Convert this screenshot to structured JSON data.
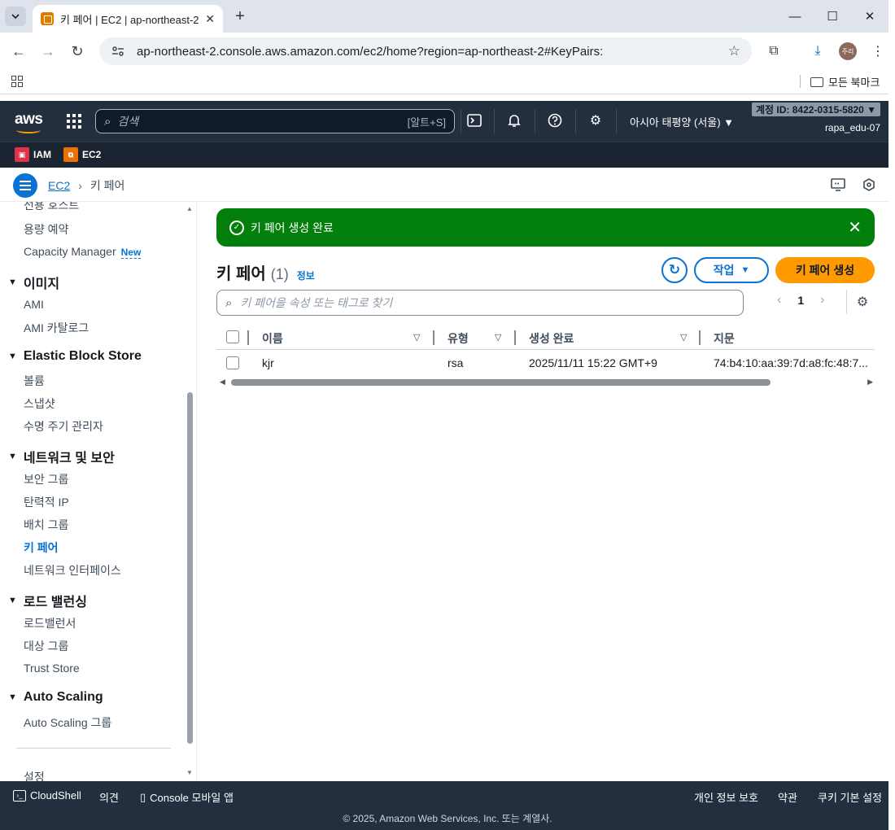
{
  "browser": {
    "tab_title": "키 페어 | EC2 | ap-northeast-2",
    "tab_close": "✕",
    "new_tab": "+",
    "url": "ap-northeast-2.console.aws.amazon.com/ec2/home?region=ap-northeast-2#KeyPairs:",
    "profile_initials": "주리",
    "bookmarks_all": "모든 북마크"
  },
  "aws_header": {
    "search_placeholder": "검색",
    "search_shortcut": "[알트+S]",
    "region": "아시아 태평양 (서울) ▼",
    "account": "계정 ID: 8422-0315-5820 ▼",
    "user": "rapa_edu-07",
    "favorites": [
      {
        "label": "IAM",
        "color": "#dd344c"
      },
      {
        "label": "EC2",
        "color": "#ed7100"
      }
    ]
  },
  "breadcrumb": {
    "parent": "EC2",
    "current": "키 페어"
  },
  "sidenav": {
    "items": [
      {
        "type": "link",
        "label": "전용 호스트"
      },
      {
        "type": "link",
        "label": "용량 예약"
      },
      {
        "type": "link",
        "label": "Capacity Manager",
        "badge": "New"
      },
      {
        "type": "section",
        "label": "이미지"
      },
      {
        "type": "link",
        "label": "AMI"
      },
      {
        "type": "link",
        "label": "AMI 카탈로그"
      },
      {
        "type": "section",
        "label": "Elastic Block Store"
      },
      {
        "type": "link",
        "label": "볼륨"
      },
      {
        "type": "link",
        "label": "스냅샷"
      },
      {
        "type": "link",
        "label": "수명 주기 관리자"
      },
      {
        "type": "section",
        "label": "네트워크 및 보안"
      },
      {
        "type": "link",
        "label": "보안 그룹"
      },
      {
        "type": "link",
        "label": "탄력적 IP"
      },
      {
        "type": "link",
        "label": "배치 그룹"
      },
      {
        "type": "link",
        "label": "키 페어",
        "active": true
      },
      {
        "type": "link",
        "label": "네트워크 인터페이스"
      },
      {
        "type": "section",
        "label": "로드 밸런싱"
      },
      {
        "type": "link",
        "label": "로드밸런서"
      },
      {
        "type": "link",
        "label": "대상 그룹"
      },
      {
        "type": "link",
        "label": "Trust Store"
      },
      {
        "type": "section",
        "label": "Auto Scaling"
      },
      {
        "type": "link",
        "label": "Auto Scaling 그룹"
      },
      {
        "type": "link",
        "label": "설정"
      }
    ]
  },
  "flash": {
    "message": "키 페어 생성 완료",
    "status_color": "#037f0c"
  },
  "main": {
    "title": "키 페어",
    "count": "(1)",
    "info": "정보",
    "actions_label": "작업",
    "create_label": "키 페어 생성",
    "filter_placeholder": "키 페어을 속성 또는 태그로 찾기",
    "page": "1"
  },
  "table": {
    "columns": [
      "이름",
      "유형",
      "생성 완료",
      "지문"
    ],
    "rows": [
      {
        "name": "kjr",
        "type": "rsa",
        "created": "2025/11/11 15:22 GMT+9",
        "fingerprint": "74:b4:10:aa:39:7d:a8:fc:48:7..."
      }
    ]
  },
  "footer": {
    "cloudshell": "CloudShell",
    "feedback": "의견",
    "mobile": "Console 모바일 앱",
    "privacy": "개인 정보 보호",
    "terms": "약관",
    "cookies": "쿠키 기본 설정",
    "copyright": "© 2025, Amazon Web Services, Inc. 또는 계열사."
  },
  "colors": {
    "aws_nav": "#232f3e",
    "link_blue": "#0972d3",
    "primary_orange": "#ff9900"
  }
}
